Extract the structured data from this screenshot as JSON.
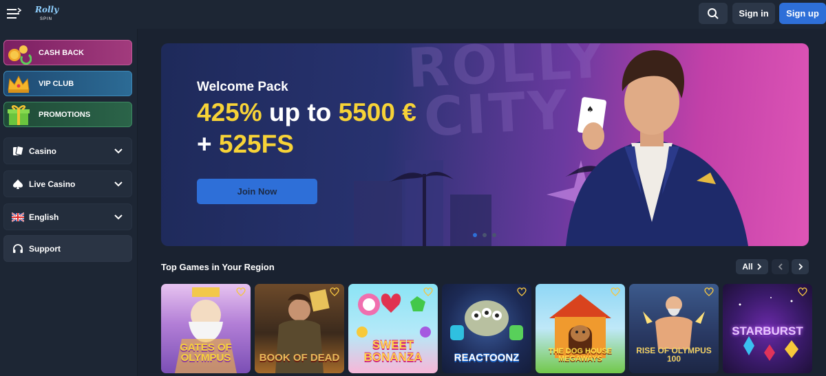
{
  "header": {
    "logo_text": "Rolly",
    "logo_sub": "SPIN",
    "signin_label": "Sign in",
    "signup_label": "Sign up"
  },
  "sidebar": {
    "promos": [
      {
        "label": "CASH BACK",
        "icon": "cashback-icon"
      },
      {
        "label": "VIP CLUB",
        "icon": "crown-icon"
      },
      {
        "label": "PROMOTIONS",
        "icon": "gift-icon"
      }
    ],
    "nav": [
      {
        "label": "Casino",
        "icon": "cards-icon"
      },
      {
        "label": "Live Casino",
        "icon": "spade-icon"
      },
      {
        "label": "English",
        "icon": "uk-flag-icon"
      },
      {
        "label": "Support",
        "icon": "headset-icon"
      }
    ]
  },
  "hero": {
    "bg_text_line1": "ROLLY",
    "bg_text_line2": "CITY",
    "title": "Welcome Pack",
    "offer_pct": "425%",
    "offer_mid": " up to ",
    "offer_amount": "5500 €",
    "offer_plus": "+ ",
    "offer_fs": "525FS",
    "cta_label": "Join Now",
    "slides": 3,
    "active_slide": 1
  },
  "games": {
    "section_title": "Top Games in Your Region",
    "all_label": "All",
    "items": [
      {
        "name": "Gates of Olympus"
      },
      {
        "name": "Book of Dead"
      },
      {
        "name": "Sweet Bonanza"
      },
      {
        "name": "Reactoonz"
      },
      {
        "name": "The Dog House Megaways"
      },
      {
        "name": "Rise of Olympus 100"
      },
      {
        "name": "Starburst"
      }
    ]
  },
  "colors": {
    "accent_blue": "#2e6fd8",
    "highlight_yellow": "#f7d337",
    "bg": "#1a2230"
  }
}
